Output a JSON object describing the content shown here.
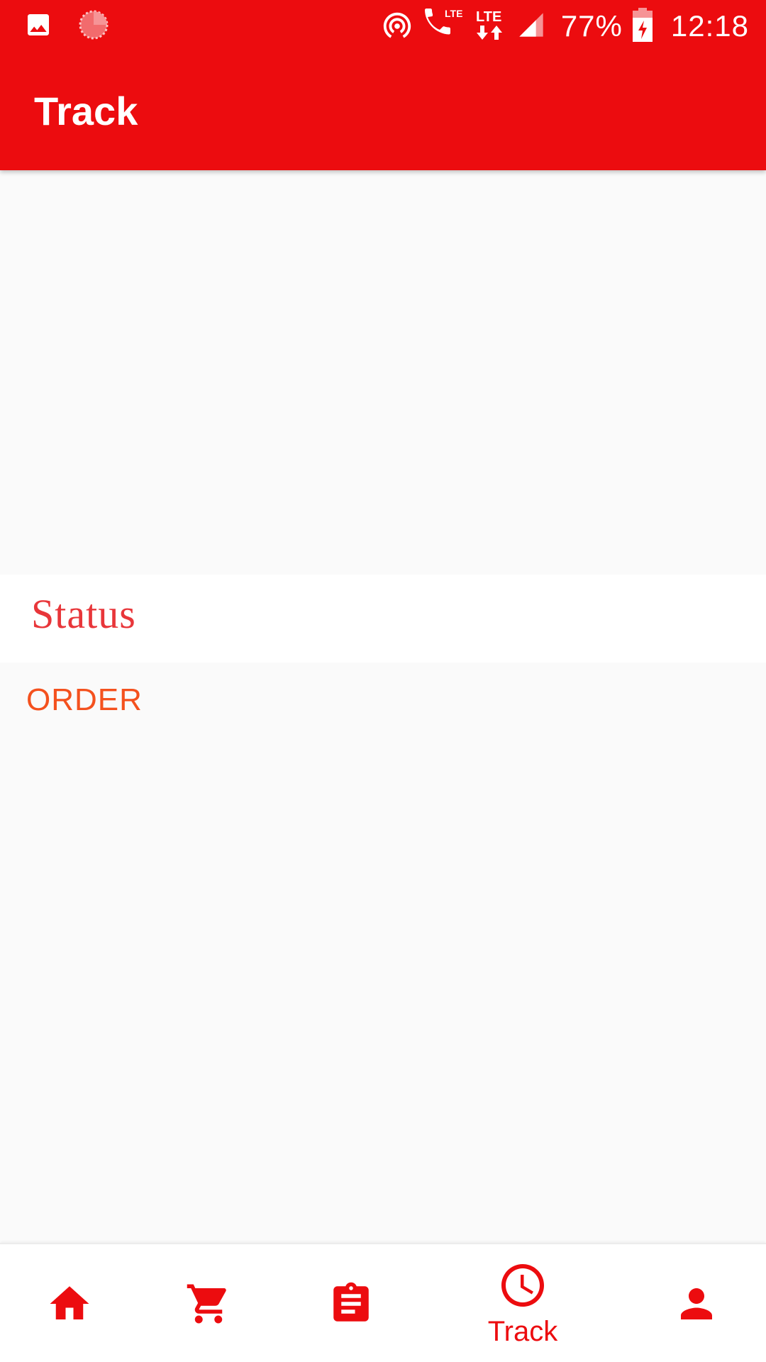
{
  "status_bar": {
    "battery_percent": "77%",
    "time": "12:18",
    "icons": [
      "image-icon",
      "loading-icon",
      "hotspot-icon",
      "volte-call-icon",
      "lte-data-icon",
      "signal-icon",
      "battery-charging-icon"
    ]
  },
  "app_bar": {
    "title": "Track"
  },
  "main": {
    "status_heading": "Status",
    "order_label": "ORDER"
  },
  "bottom_nav": {
    "items": [
      {
        "icon": "home-icon",
        "label": ""
      },
      {
        "icon": "cart-icon",
        "label": ""
      },
      {
        "icon": "clipboard-icon",
        "label": ""
      },
      {
        "icon": "clock-icon",
        "label": "Track",
        "active": true
      },
      {
        "icon": "person-icon",
        "label": ""
      }
    ]
  },
  "colors": {
    "primary": "#EC0C0F",
    "status_text": "#E8363A",
    "order_text": "#F4511E",
    "background": "#FAFAFA"
  }
}
